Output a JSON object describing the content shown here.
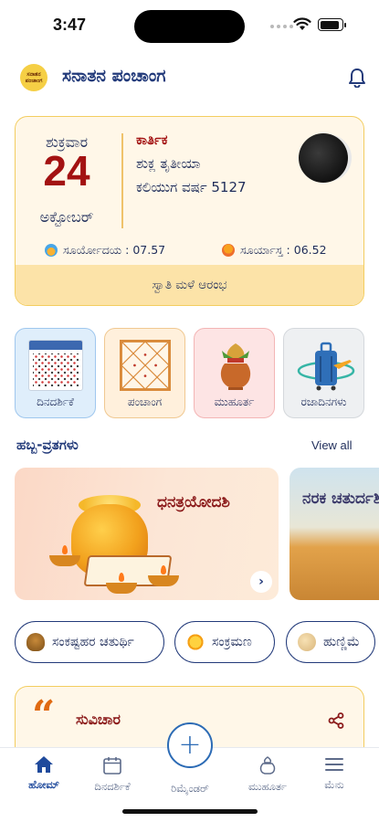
{
  "status": {
    "time": "3:47",
    "battery_level": 0.9
  },
  "header": {
    "logo_text": "ಸನಾತನ ಪಂಚಾಂಗ",
    "title": "ಸನಾತನ ಪಂಚಾಂಗ",
    "icon": "bell-icon"
  },
  "today": {
    "weekday": "ಶುಕ್ರವಾರ",
    "day": "24",
    "month": "ಅಕ್ಟೋಬರ್",
    "masa": "ಕಾರ್ತಿಕ",
    "tithi": "ಶುಕ್ಲ ತೃತೀಯಾ",
    "era": "ಕಲಿಯುಗ ವರ್ಷ 5127",
    "sunrise": "ಸೂರ್ಯೋದಯ : 07.57",
    "sunset": "ಸೂರ್ಯಾಸ್ತ : 06.52",
    "event": "ಸ್ವಾತಿ ಮಳೆ ಆರಂಭ"
  },
  "tiles": [
    {
      "label": "ದಿನದರ್ಶಿಕೆ",
      "icon": "calendar-icon"
    },
    {
      "label": "ಪಂಚಾಂಗ",
      "icon": "kundli-chart-icon"
    },
    {
      "label": "ಮುಹೂರ್ತ",
      "icon": "kalash-icon"
    },
    {
      "label": "ರಜಾದಿನಗಳು",
      "icon": "travel-bag-icon"
    }
  ],
  "festivals": {
    "title": "ಹಬ್ಬ-ವ್ರತಗಳು",
    "view_all": "View all",
    "cards": [
      {
        "name": "ಧನತ್ರಯೋದಶಿ"
      },
      {
        "name": "ನರಕ ಚತುರ್ದಶಿ"
      }
    ]
  },
  "pills": [
    {
      "label": "ಸಂಕಷ್ಟಹರ ಚತುರ್ಥಿ",
      "icon": "modak-icon"
    },
    {
      "label": "ಸಂಕ್ರಮಣ",
      "icon": "sun-icon"
    },
    {
      "label": "ಹುಣ್ಣಿಮೆ",
      "icon": "full-moon-icon"
    }
  ],
  "quote": {
    "mark": "“",
    "title": "ಸುವಿಚಾರ"
  },
  "tabbar": {
    "fab": "+",
    "items": [
      {
        "label": "ಹೋಮ್",
        "icon": "home-icon",
        "active": true
      },
      {
        "label": "ದಿನದರ್ಶಿಕೆ",
        "icon": "calendar-icon"
      },
      {
        "label": "ರಿಮೈಂಡರ್",
        "icon": "plus-icon"
      },
      {
        "label": "ಮುಹೂರ್ತ",
        "icon": "kalash-icon"
      },
      {
        "label": "ಮೆನು",
        "icon": "menu-icon"
      }
    ]
  },
  "colors": {
    "primary": "#223a7a",
    "accent_red": "#a31212",
    "card_bg": "#fff7e8",
    "card_border": "#f3cd5f",
    "fab": "#2c6bb5"
  }
}
